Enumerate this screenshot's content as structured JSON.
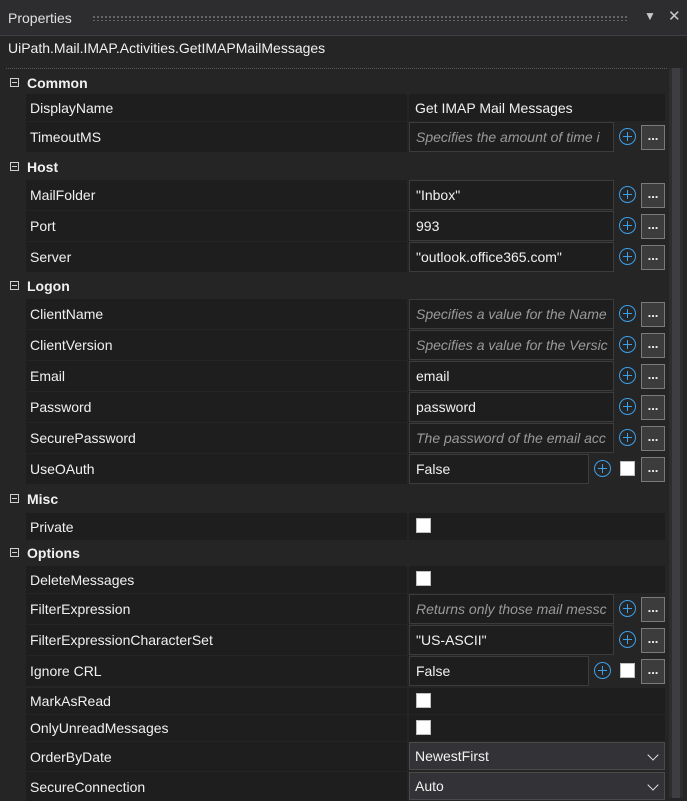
{
  "panel": {
    "title": "Properties",
    "pin_icon": "chevron-down-pin",
    "close_icon": "x",
    "type_name": "UiPath.Mail.IMAP.Activities.GetIMAPMailMessages"
  },
  "categories": {
    "common": "Common",
    "host": "Host",
    "logon": "Logon",
    "misc": "Misc",
    "options": "Options"
  },
  "props": {
    "displayname": {
      "name": "DisplayName",
      "value": "Get IMAP Mail Messages"
    },
    "timeoutms": {
      "name": "TimeoutMS",
      "placeholder": "Specifies the amount of time i"
    },
    "mailfolder": {
      "name": "MailFolder",
      "value": "\"Inbox\""
    },
    "port": {
      "name": "Port",
      "value": "993"
    },
    "server": {
      "name": "Server",
      "value": "\"outlook.office365.com\""
    },
    "clientname": {
      "name": "ClientName",
      "placeholder": "Specifies a value for the Name"
    },
    "clientversion": {
      "name": "ClientVersion",
      "placeholder": "Specifies a value for the Versic"
    },
    "email": {
      "name": "Email",
      "value": "email"
    },
    "password": {
      "name": "Password",
      "value": "password"
    },
    "securepassword": {
      "name": "SecurePassword",
      "placeholder": "The password of the email acc"
    },
    "useoauth": {
      "name": "UseOAuth",
      "value": "False"
    },
    "private": {
      "name": "Private"
    },
    "deletemessages": {
      "name": "DeleteMessages"
    },
    "filterexpression": {
      "name": "FilterExpression",
      "placeholder": "Returns only those mail messc"
    },
    "filterexpressioncharset": {
      "name": "FilterExpressionCharacterSet",
      "value": "\"US-ASCII\""
    },
    "ignorecrl": {
      "name": "Ignore CRL",
      "value": "False"
    },
    "markasread": {
      "name": "MarkAsRead"
    },
    "onlyunread": {
      "name": "OnlyUnreadMessages"
    },
    "orderbydate": {
      "name": "OrderByDate",
      "value": "NewestFirst"
    },
    "secureconnection": {
      "name": "SecureConnection",
      "value": "Auto"
    }
  },
  "buttons": {
    "more": "..."
  }
}
